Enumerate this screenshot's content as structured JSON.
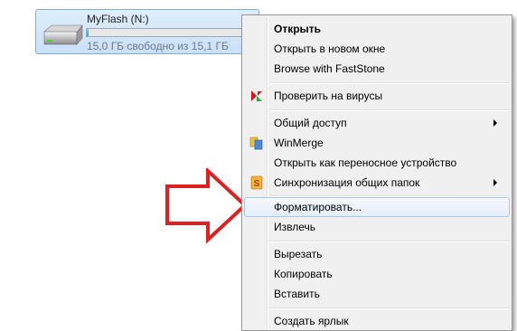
{
  "drive": {
    "name": "MyFlash (N:)",
    "space": "15,0 ГБ свободно из 15,1 ГБ",
    "used_fraction": 0.01
  },
  "menu": {
    "items": [
      {
        "label": "Открыть",
        "bold": true
      },
      {
        "label": "Открыть в новом окне"
      },
      {
        "label": "Browse with FastStone"
      },
      {
        "label": "Проверить на вирусы",
        "icon": "kaspersky-icon"
      },
      {
        "label": "Общий доступ",
        "submenu": true
      },
      {
        "label": "WinMerge",
        "icon": "winmerge-icon"
      },
      {
        "label": "Открыть как переносное устройство"
      },
      {
        "label": "Синхронизация общих папок",
        "icon": "sync-icon",
        "submenu": true
      },
      {
        "label": "Форматировать...",
        "highlighted": true
      },
      {
        "label": "Извлечь"
      },
      {
        "label": "Вырезать"
      },
      {
        "label": "Копировать"
      },
      {
        "label": "Вставить"
      },
      {
        "label": "Создать ярлык"
      }
    ]
  },
  "annotation": {
    "arrow_color": "#e02020"
  }
}
